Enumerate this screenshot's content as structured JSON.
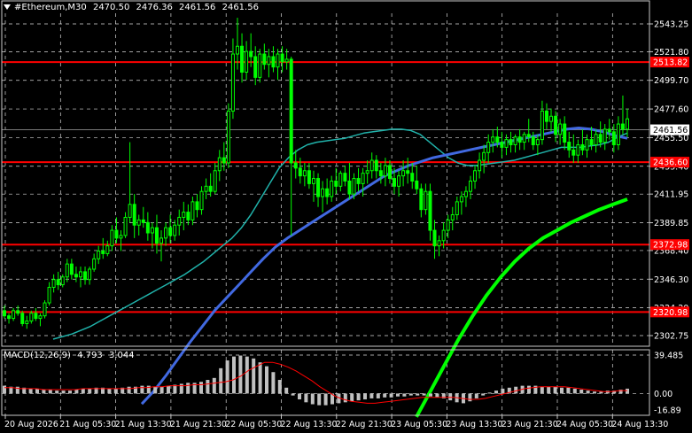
{
  "header": {
    "symbol": "#Ethereum,M30",
    "open": "2470.50",
    "high": "2476.36",
    "low": "2461.56",
    "close": "2461.56"
  },
  "macd_header": {
    "label": "MACD(12,26,9)",
    "main": "4.793",
    "signal": "3.044"
  },
  "colors": {
    "background": "#000000",
    "grid": "#ffffff",
    "candles": "#00ff00",
    "level_lines": "#ff0000",
    "ma_fast": "#20b2aa",
    "ma_mid": "#4169e1",
    "ma_slow": "#00ff00",
    "macd_hist": "#c0c0c0",
    "macd_signal": "#ff0000",
    "current_price_tag": "#ffffff",
    "level_tag": "#ff0000"
  },
  "price_axis": {
    "min": 2302.75,
    "max": 2543.25,
    "labels": [
      "2543.25",
      "2521.80",
      "2499.70",
      "2477.60",
      "2455.50",
      "2433.40",
      "2411.95",
      "2389.85",
      "2368.40",
      "2346.30",
      "2324.20",
      "2302.75"
    ]
  },
  "level_lines": [
    {
      "price": 2513.82,
      "label": "2513.82"
    },
    {
      "price": 2436.6,
      "label": "2436.60"
    },
    {
      "price": 2372.98,
      "label": "2372.98"
    },
    {
      "price": 2320.98,
      "label": "2320.98"
    }
  ],
  "current_price": {
    "price": 2461.56,
    "label": "2461.56"
  },
  "macd_axis": {
    "min": -16.89,
    "max": 39.485,
    "labels": [
      "39.485",
      "0.00",
      "-16.89"
    ]
  },
  "time_axis": {
    "labels": [
      "20 Aug 2026",
      "21 Aug 05:30",
      "21 Aug 13:30",
      "21 Aug 21:30",
      "22 Aug 05:30",
      "22 Aug 13:30",
      "22 Aug 21:30",
      "23 Aug 05:30",
      "23 Aug 13:30",
      "23 Aug 21:30",
      "24 Aug 05:30",
      "24 Aug 13:30"
    ]
  },
  "chart_data": {
    "type": "candlestick",
    "symbol": "#Ethereum",
    "timeframe": "M30",
    "bars": [
      [
        2322,
        2326,
        2316,
        2318
      ],
      [
        2318,
        2320,
        2312,
        2316
      ],
      [
        2316,
        2324,
        2314,
        2322
      ],
      [
        2322,
        2326,
        2318,
        2320
      ],
      [
        2320,
        2322,
        2310,
        2312
      ],
      [
        2312,
        2318,
        2308,
        2314
      ],
      [
        2314,
        2322,
        2312,
        2320
      ],
      [
        2320,
        2324,
        2314,
        2316
      ],
      [
        2316,
        2320,
        2310,
        2318
      ],
      [
        2318,
        2330,
        2316,
        2328
      ],
      [
        2328,
        2344,
        2326,
        2340
      ],
      [
        2340,
        2350,
        2336,
        2346
      ],
      [
        2346,
        2352,
        2338,
        2342
      ],
      [
        2342,
        2350,
        2340,
        2348
      ],
      [
        2348,
        2362,
        2344,
        2358
      ],
      [
        2358,
        2362,
        2346,
        2350
      ],
      [
        2350,
        2356,
        2344,
        2348
      ],
      [
        2348,
        2356,
        2340,
        2352
      ],
      [
        2352,
        2356,
        2342,
        2346
      ],
      [
        2346,
        2356,
        2342,
        2354
      ],
      [
        2354,
        2366,
        2352,
        2362
      ],
      [
        2362,
        2372,
        2358,
        2368
      ],
      [
        2368,
        2378,
        2362,
        2366
      ],
      [
        2366,
        2376,
        2364,
        2372
      ],
      [
        2372,
        2388,
        2368,
        2384
      ],
      [
        2384,
        2394,
        2374,
        2378
      ],
      [
        2378,
        2384,
        2368,
        2380
      ],
      [
        2380,
        2398,
        2378,
        2394
      ],
      [
        2394,
        2452,
        2390,
        2404
      ],
      [
        2404,
        2412,
        2378,
        2388
      ],
      [
        2388,
        2396,
        2380,
        2392
      ],
      [
        2392,
        2402,
        2386,
        2390
      ],
      [
        2390,
        2398,
        2376,
        2382
      ],
      [
        2382,
        2390,
        2370,
        2386
      ],
      [
        2386,
        2396,
        2366,
        2374
      ],
      [
        2374,
        2384,
        2360,
        2378
      ],
      [
        2378,
        2390,
        2372,
        2386
      ],
      [
        2386,
        2396,
        2374,
        2380
      ],
      [
        2380,
        2392,
        2376,
        2388
      ],
      [
        2388,
        2400,
        2380,
        2394
      ],
      [
        2394,
        2406,
        2384,
        2398
      ],
      [
        2398,
        2404,
        2388,
        2392
      ],
      [
        2392,
        2410,
        2388,
        2406
      ],
      [
        2406,
        2412,
        2394,
        2400
      ],
      [
        2400,
        2418,
        2396,
        2414
      ],
      [
        2414,
        2424,
        2408,
        2418
      ],
      [
        2418,
        2428,
        2410,
        2414
      ],
      [
        2414,
        2436,
        2412,
        2430
      ],
      [
        2430,
        2446,
        2422,
        2440
      ],
      [
        2440,
        2452,
        2430,
        2436
      ],
      [
        2436,
        2482,
        2432,
        2476
      ],
      [
        2476,
        2532,
        2470,
        2520
      ],
      [
        2520,
        2548,
        2508,
        2526
      ],
      [
        2526,
        2536,
        2498,
        2506
      ],
      [
        2506,
        2530,
        2500,
        2522
      ],
      [
        2522,
        2536,
        2510,
        2518
      ],
      [
        2518,
        2526,
        2496,
        2502
      ],
      [
        2502,
        2524,
        2498,
        2520
      ],
      [
        2520,
        2528,
        2508,
        2512
      ],
      [
        2512,
        2524,
        2502,
        2518
      ],
      [
        2518,
        2526,
        2506,
        2510
      ],
      [
        2510,
        2524,
        2500,
        2520
      ],
      [
        2520,
        2526,
        2506,
        2514
      ],
      [
        2514,
        2524,
        2508,
        2516
      ],
      [
        2516,
        2518,
        2380,
        2436
      ],
      [
        2436,
        2446,
        2424,
        2432
      ],
      [
        2432,
        2440,
        2420,
        2426
      ],
      [
        2426,
        2436,
        2418,
        2430
      ],
      [
        2430,
        2436,
        2416,
        2420
      ],
      [
        2420,
        2430,
        2406,
        2424
      ],
      [
        2424,
        2428,
        2402,
        2410
      ],
      [
        2410,
        2422,
        2398,
        2416
      ],
      [
        2416,
        2424,
        2404,
        2410
      ],
      [
        2410,
        2426,
        2406,
        2422
      ],
      [
        2422,
        2432,
        2412,
        2418
      ],
      [
        2418,
        2430,
        2414,
        2428
      ],
      [
        2428,
        2434,
        2418,
        2422
      ],
      [
        2422,
        2436,
        2408,
        2412
      ],
      [
        2412,
        2428,
        2408,
        2424
      ],
      [
        2424,
        2432,
        2414,
        2420
      ],
      [
        2420,
        2432,
        2410,
        2428
      ],
      [
        2428,
        2438,
        2420,
        2430
      ],
      [
        2430,
        2444,
        2424,
        2438
      ],
      [
        2438,
        2442,
        2424,
        2430
      ],
      [
        2430,
        2436,
        2420,
        2426
      ],
      [
        2426,
        2440,
        2418,
        2434
      ],
      [
        2434,
        2438,
        2420,
        2424
      ],
      [
        2424,
        2432,
        2412,
        2418
      ],
      [
        2418,
        2430,
        2410,
        2426
      ],
      [
        2426,
        2438,
        2418,
        2430
      ],
      [
        2430,
        2440,
        2420,
        2428
      ],
      [
        2428,
        2436,
        2416,
        2422
      ],
      [
        2422,
        2434,
        2412,
        2416
      ],
      [
        2416,
        2420,
        2394,
        2400
      ],
      [
        2400,
        2420,
        2396,
        2414
      ],
      [
        2414,
        2420,
        2376,
        2384
      ],
      [
        2384,
        2392,
        2362,
        2372
      ],
      [
        2372,
        2380,
        2364,
        2376
      ],
      [
        2376,
        2390,
        2370,
        2384
      ],
      [
        2384,
        2396,
        2378,
        2392
      ],
      [
        2392,
        2402,
        2384,
        2396
      ],
      [
        2396,
        2410,
        2392,
        2406
      ],
      [
        2406,
        2414,
        2396,
        2410
      ],
      [
        2410,
        2418,
        2402,
        2414
      ],
      [
        2414,
        2426,
        2408,
        2422
      ],
      [
        2422,
        2434,
        2416,
        2430
      ],
      [
        2430,
        2444,
        2424,
        2438
      ],
      [
        2438,
        2450,
        2428,
        2444
      ],
      [
        2444,
        2458,
        2436,
        2452
      ],
      [
        2452,
        2462,
        2444,
        2456
      ],
      [
        2456,
        2464,
        2448,
        2452
      ],
      [
        2452,
        2460,
        2440,
        2448
      ],
      [
        2448,
        2458,
        2442,
        2454
      ],
      [
        2454,
        2460,
        2444,
        2450
      ],
      [
        2450,
        2458,
        2444,
        2456
      ],
      [
        2456,
        2462,
        2446,
        2452
      ],
      [
        2452,
        2460,
        2446,
        2458
      ],
      [
        2458,
        2470,
        2452,
        2456
      ],
      [
        2456,
        2460,
        2446,
        2450
      ],
      [
        2450,
        2458,
        2442,
        2454
      ],
      [
        2454,
        2484,
        2450,
        2476
      ],
      [
        2476,
        2482,
        2462,
        2468
      ],
      [
        2468,
        2478,
        2460,
        2472
      ],
      [
        2472,
        2476,
        2452,
        2458
      ],
      [
        2458,
        2470,
        2450,
        2466
      ],
      [
        2466,
        2472,
        2446,
        2452
      ],
      [
        2452,
        2460,
        2440,
        2446
      ],
      [
        2446,
        2458,
        2436,
        2442
      ],
      [
        2442,
        2454,
        2436,
        2450
      ],
      [
        2450,
        2462,
        2442,
        2446
      ],
      [
        2446,
        2458,
        2440,
        2454
      ],
      [
        2454,
        2464,
        2446,
        2450
      ],
      [
        2450,
        2462,
        2444,
        2458
      ],
      [
        2458,
        2468,
        2448,
        2452
      ],
      [
        2452,
        2466,
        2446,
        2462
      ],
      [
        2462,
        2470,
        2454,
        2460
      ],
      [
        2460,
        2466,
        2444,
        2450
      ],
      [
        2450,
        2472,
        2446,
        2466
      ],
      [
        2466,
        2488,
        2458,
        2462
      ],
      [
        2462,
        2478,
        2456,
        2470
      ]
    ],
    "ma_fast": [
      2300,
      2302,
      2304,
      2307,
      2310,
      2314,
      2318,
      2322,
      2326,
      2330,
      2334,
      2338,
      2342,
      2346,
      2350,
      2355,
      2360,
      2366,
      2372,
      2378,
      2386,
      2396,
      2408,
      2420,
      2432,
      2440,
      2446,
      2450,
      2452,
      2453,
      2454,
      2455,
      2457,
      2459,
      2460,
      2461,
      2462,
      2462,
      2461,
      2458,
      2452,
      2446,
      2440,
      2436,
      2434,
      2434,
      2435,
      2436,
      2437,
      2438,
      2440,
      2442,
      2444,
      2446,
      2448,
      2448,
      2448,
      2449,
      2450,
      2452,
      2456,
      2459
    ],
    "ma_mid": [
      2250,
      2260,
      2272,
      2285,
      2298,
      2310,
      2322,
      2332,
      2342,
      2352,
      2362,
      2371,
      2378,
      2384,
      2390,
      2396,
      2402,
      2408,
      2414,
      2420,
      2426,
      2430,
      2434,
      2437,
      2440,
      2442,
      2444,
      2446,
      2448,
      2450,
      2452,
      2454,
      2456,
      2458,
      2460,
      2462,
      2463,
      2462,
      2460,
      2457,
      2455
    ],
    "ma_slow": [
      2240,
      2260,
      2280,
      2300,
      2318,
      2334,
      2348,
      2360,
      2370,
      2378,
      2384,
      2390,
      2395,
      2400,
      2404,
      2408
    ],
    "macd_hist": [
      8,
      7,
      7,
      6,
      5,
      5,
      4,
      4,
      3,
      3,
      3,
      4,
      5,
      5,
      6,
      6,
      5,
      5,
      6,
      7,
      7,
      8,
      8,
      7,
      7,
      8,
      9,
      10,
      11,
      11,
      12,
      14,
      16,
      26,
      34,
      38,
      39,
      38,
      36,
      32,
      28,
      22,
      14,
      6,
      -2,
      -6,
      -9,
      -11,
      -12,
      -12,
      -11,
      -10,
      -9,
      -8,
      -7,
      -6,
      -5,
      -5,
      -4,
      -4,
      -3,
      -3,
      -2,
      -2,
      -2,
      -3,
      -4,
      -5,
      -7,
      -9,
      -10,
      -8,
      -5,
      -2,
      1,
      3,
      5,
      6,
      7,
      8,
      8,
      8,
      7,
      7,
      7,
      6,
      6,
      5,
      4,
      3,
      2,
      2,
      3,
      3,
      4,
      5
    ],
    "macd_signal": [
      6,
      6,
      5,
      5,
      5,
      4,
      4,
      4,
      4,
      4,
      5,
      5,
      5,
      5,
      5,
      5,
      5,
      6,
      6,
      7,
      7,
      8,
      8,
      8,
      9,
      9,
      10,
      11,
      12,
      14,
      18,
      24,
      28,
      32,
      32,
      30,
      27,
      23,
      18,
      13,
      7,
      2,
      -3,
      -6,
      -8,
      -9,
      -10,
      -10,
      -9,
      -8,
      -7,
      -6,
      -5,
      -4,
      -4,
      -4,
      -4,
      -4,
      -5,
      -6,
      -6,
      -5,
      -3,
      -1,
      1,
      3,
      5,
      6,
      7,
      7,
      7,
      7,
      6,
      5,
      4,
      3,
      2,
      2,
      3,
      3
    ]
  }
}
